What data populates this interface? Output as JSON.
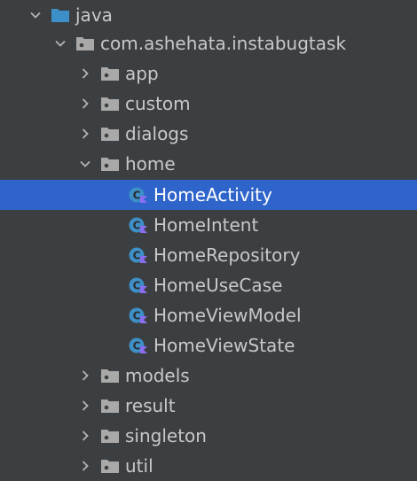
{
  "colors": {
    "background": "#3c3f41",
    "selection": "#2f65ca",
    "text": "#c8c8c8",
    "selected_text": "#ffffff",
    "folder_blue": "#3d8fc7",
    "package_gray": "#a9a9a9",
    "kotlin_class": "#3d8fc7",
    "kotlin_badge": "#8b6df1",
    "chevron": "#b4b4b4"
  },
  "tree": {
    "java": {
      "label": "java",
      "expanded": true,
      "icon": "source-folder-icon"
    },
    "package": {
      "label": "com.ashehata.instabugtask",
      "expanded": true,
      "icon": "package-folder-icon"
    },
    "app": {
      "label": "app",
      "expanded": false,
      "icon": "package-folder-icon"
    },
    "custom": {
      "label": "custom",
      "expanded": false,
      "icon": "package-folder-icon"
    },
    "dialogs": {
      "label": "dialogs",
      "expanded": false,
      "icon": "package-folder-icon"
    },
    "home": {
      "label": "home",
      "expanded": true,
      "icon": "package-folder-icon"
    },
    "home_files": [
      {
        "label": "HomeActivity",
        "selected": true,
        "icon": "kotlin-class-icon"
      },
      {
        "label": "HomeIntent",
        "selected": false,
        "icon": "kotlin-class-icon"
      },
      {
        "label": "HomeRepository",
        "selected": false,
        "icon": "kotlin-class-icon"
      },
      {
        "label": "HomeUseCase",
        "selected": false,
        "icon": "kotlin-class-icon"
      },
      {
        "label": "HomeViewModel",
        "selected": false,
        "icon": "kotlin-class-icon"
      },
      {
        "label": "HomeViewState",
        "selected": false,
        "icon": "kotlin-class-icon"
      }
    ],
    "models": {
      "label": "models",
      "expanded": false,
      "icon": "package-folder-icon"
    },
    "result": {
      "label": "result",
      "expanded": false,
      "icon": "package-folder-icon"
    },
    "singleton": {
      "label": "singleton",
      "expanded": false,
      "icon": "package-folder-icon"
    },
    "util": {
      "label": "util",
      "expanded": false,
      "icon": "package-folder-icon"
    }
  }
}
